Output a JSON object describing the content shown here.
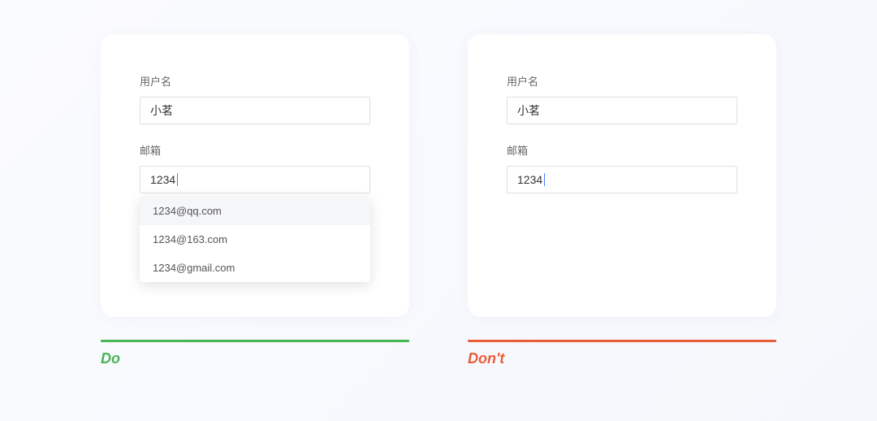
{
  "do": {
    "fields": {
      "username": {
        "label": "用户名",
        "value": "小茗"
      },
      "email": {
        "label": "邮箱",
        "value": "1234"
      }
    },
    "suggestions": [
      "1234@qq.com",
      "1234@163.com",
      "1234@gmail.com"
    ],
    "ruleLabel": "Do"
  },
  "dont": {
    "fields": {
      "username": {
        "label": "用户名",
        "value": "小茗"
      },
      "email": {
        "label": "邮箱",
        "value": "1234"
      }
    },
    "ruleLabel": "Don't"
  },
  "colors": {
    "do": "#48b554",
    "dont": "#e85d3a"
  }
}
